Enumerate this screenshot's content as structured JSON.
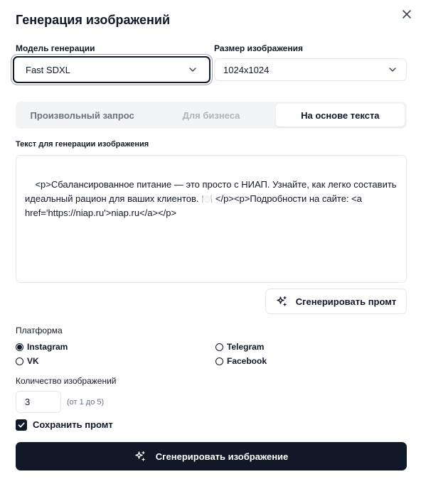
{
  "dialog": {
    "title": "Генерация изображений",
    "close_icon": "close-icon"
  },
  "model": {
    "label": "Модель генерации",
    "value": "Fast SDXL",
    "icon": "chevron-down-icon"
  },
  "size": {
    "label": "Размер изображения",
    "value": "1024x1024",
    "icon": "chevron-down-icon"
  },
  "tabs": [
    {
      "label": "Произвольный запрос",
      "state": "inactive"
    },
    {
      "label": "Для бизнеса",
      "state": "disabled"
    },
    {
      "label": "На основе текста",
      "state": "active"
    }
  ],
  "text_source": {
    "label": "Текст для генерации изображения",
    "value": "<p>Сбалансированное питание — это просто с НИАП. Узнайте, как легко составить идеальный рацион для ваших клиентов. 🍽️ </p><p>Подробности на сайте: <a href='https://niap.ru'>niap.ru</a></p>"
  },
  "generate_prompt_button": {
    "label": "Сгенерировать промт",
    "icon": "sparkles-icon"
  },
  "platform": {
    "label": "Платформа",
    "options": [
      {
        "label": "Instagram",
        "selected": true
      },
      {
        "label": "VK",
        "selected": false
      },
      {
        "label": "Telegram",
        "selected": false
      },
      {
        "label": "Facebook",
        "selected": false
      }
    ]
  },
  "count": {
    "label": "Количество изображений",
    "value": "3",
    "hint": "(от 1 до 5)"
  },
  "save_prompt": {
    "label": "Сохранить промт",
    "checked": true
  },
  "generate_image_button": {
    "label": "Сгенерировать изображение",
    "icon": "sparkles-icon"
  },
  "colors": {
    "primary": "#111827",
    "border": "#e5e7eb",
    "muted_text": "#6b7280",
    "tabs_bg": "#f3f4f6"
  }
}
